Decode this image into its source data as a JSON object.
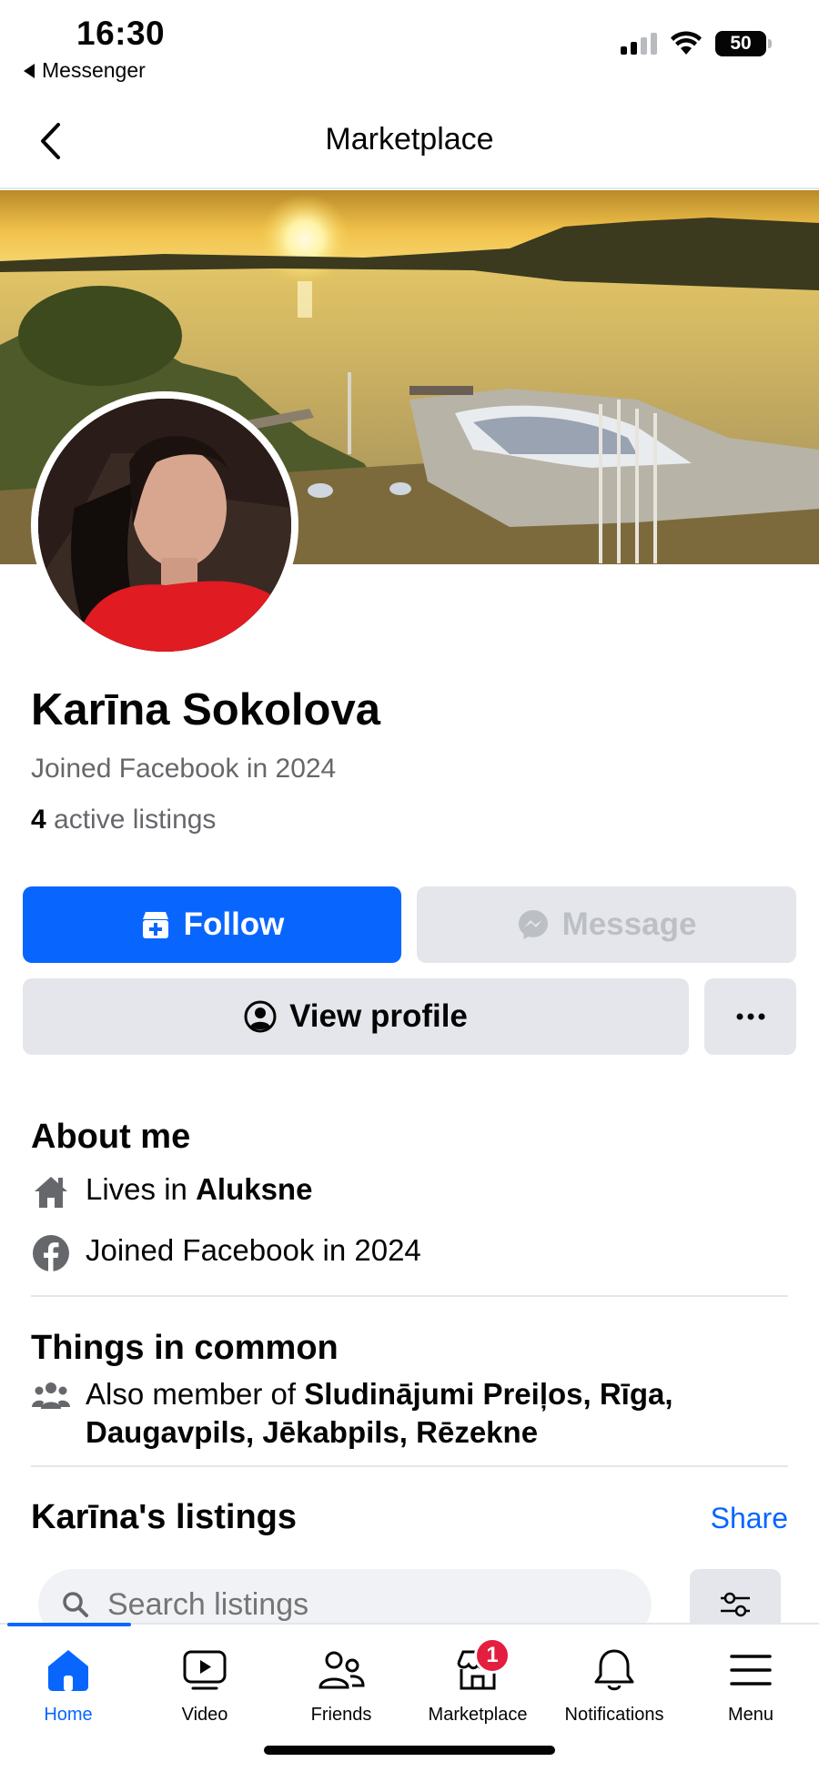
{
  "status": {
    "time": "16:30",
    "back_app": "Messenger",
    "battery": "50"
  },
  "nav": {
    "title": "Marketplace"
  },
  "profile": {
    "name": "Karīna Sokolova",
    "joined": "Joined Facebook in 2024",
    "listings_count": "4",
    "listings_suffix": "active listings"
  },
  "actions": {
    "follow": "Follow",
    "message": "Message",
    "view_profile": "View profile"
  },
  "about": {
    "title": "About me",
    "lives_prefix": "Lives in",
    "lives_city": "Aluksne",
    "joined": "Joined Facebook in 2024"
  },
  "common": {
    "title": "Things in common",
    "prefix": "Also member of",
    "groups_line1": "Sludinājumi Preiļos, Rīga,",
    "groups_line2": "Daugavpils, Jēkabpils, Rēzekne"
  },
  "listings": {
    "title": "Karīna's listings",
    "share": "Share",
    "search_placeholder": "Search listings"
  },
  "tabs": [
    {
      "label": "Home",
      "icon": "home-icon"
    },
    {
      "label": "Video",
      "icon": "video-icon"
    },
    {
      "label": "Friends",
      "icon": "friends-icon"
    },
    {
      "label": "Marketplace",
      "icon": "marketplace-icon",
      "badge": "1"
    },
    {
      "label": "Notifications",
      "icon": "bell-icon"
    },
    {
      "label": "Menu",
      "icon": "menu-icon"
    }
  ],
  "colors": {
    "accent": "#0866ff",
    "badge": "#e41e3f",
    "secondary_text": "#65676b",
    "button_gray": "#e4e6eb"
  }
}
